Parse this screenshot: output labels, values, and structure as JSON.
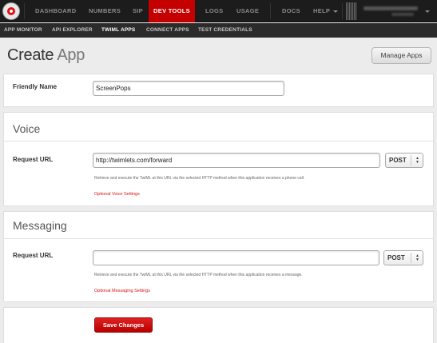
{
  "topnav": {
    "items": [
      "DASHBOARD",
      "NUMBERS",
      "SIP",
      "DEV TOOLS",
      "LOGS",
      "USAGE",
      "DOCS",
      "HELP"
    ],
    "active": "DEV TOOLS"
  },
  "subnav": {
    "items": [
      "APP MONITOR",
      "API EXPLORER",
      "TWIML APPS",
      "CONNECT APPS",
      "TEST CREDENTIALS"
    ],
    "active": "TWIML APPS"
  },
  "header": {
    "title_main": "Create",
    "title_light": "App",
    "manage_button": "Manage Apps"
  },
  "general": {
    "friendly_name_label": "Friendly Name",
    "friendly_name_value": "ScreenPops"
  },
  "voice": {
    "section_title": "Voice",
    "request_url_label": "Request URL",
    "request_url_value": "http://twimlets.com/forward",
    "method": "POST",
    "help_text": "Retrieve and execute the TwiML at this URL via the selected HTTP method when this application receives a phone call.",
    "optional_link": "Optional Voice Settings"
  },
  "messaging": {
    "section_title": "Messaging",
    "request_url_label": "Request URL",
    "request_url_value": "",
    "method": "POST",
    "help_text": "Retrieve and execute the TwiML at this URL via the selected HTTP method when this application receives a message.",
    "optional_link": "Optional Messaging Settings"
  },
  "footer": {
    "save_button": "Save Changes"
  },
  "colors": {
    "brand_red": "#c40000",
    "nav_dark": "#1c1c1c",
    "subnav_dark": "#2b2b2b",
    "link_red": "#dd1111"
  }
}
